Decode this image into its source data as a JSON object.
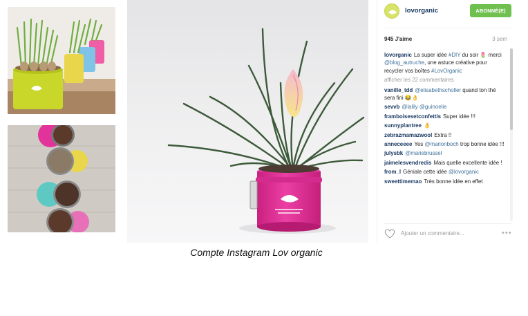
{
  "profile": {
    "username": "lovorganic",
    "follow_label": "ABONNÉ(E)"
  },
  "post": {
    "likes": "945 J'aime",
    "age": "3 sem",
    "caption_user": "lovorganic",
    "caption_text_1": "La super idée",
    "caption_tag_diy": "#DIY",
    "caption_text_2": "du soir 🌷 merci",
    "caption_mention": "@blog_autruche",
    "caption_text_3": ", une astuce créative pour recycler vos boîtes",
    "caption_tag_brand": "#LovOrganic",
    "more_comments": "afficher les 22 commentaires"
  },
  "comments": [
    {
      "user": "vanille_tdd",
      "mention": "@elisabethscholler",
      "text": " quand ton thé sera fini 😂👌"
    },
    {
      "user": "sevvb",
      "mention": "@lalily @guinoelie",
      "text": ""
    },
    {
      "user": "framboisesetconfettis",
      "mention": "",
      "text": "Super idée !!!"
    },
    {
      "user": "sunnyplantree",
      "mention": "",
      "text": "👌"
    },
    {
      "user": "zebrazmamazwool",
      "mention": "",
      "text": "Extra !!"
    },
    {
      "user": "anneceeee",
      "mention": "",
      "text": "Yes ",
      "mention2": "@marionboch",
      "text2": " trop bonne idée !!!"
    },
    {
      "user": "julysbk",
      "mention": "@mariebrussel",
      "text": ""
    },
    {
      "user": "jaimelesvendredis",
      "mention": "",
      "text": "Mais quelle excellente idée !"
    },
    {
      "user": "from_l",
      "mention": "",
      "text": "Géniale cette idée ",
      "mention2": "@lovorganic",
      "text2": ""
    },
    {
      "user": "sweettimemao",
      "mention": "",
      "text": "Très bonne idée en effet"
    }
  ],
  "footer": {
    "add_comment_placeholder": "Ajouter un commentaire...",
    "options_glyph": "•••"
  },
  "figure_caption": "Compte Instagram Lov organic",
  "colors": {
    "follow_green": "#70c050",
    "username_blue": "#1a3a63",
    "link_blue": "#3f729b",
    "pot_magenta": "#e2339b",
    "tin_lime": "#c9d72a"
  },
  "icons": [
    "heart-icon",
    "options-icon",
    "avatar-logo-icon"
  ]
}
